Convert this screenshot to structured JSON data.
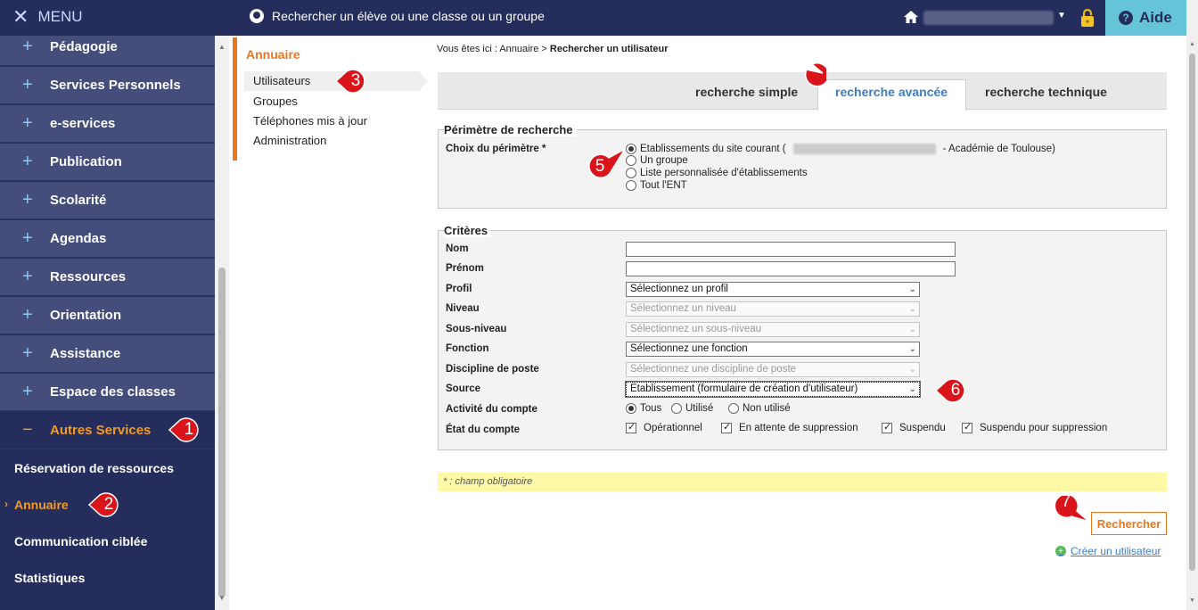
{
  "topbar": {
    "menu_label": "MENU",
    "search_placeholder": "Rechercher un élève ou une classe ou un groupe",
    "help_label": "Aide"
  },
  "sidebar": {
    "items": [
      {
        "label": "Pédagogie",
        "icon": "+"
      },
      {
        "label": "Services Personnels",
        "icon": "+"
      },
      {
        "label": "e-services",
        "icon": "+"
      },
      {
        "label": "Publication",
        "icon": "+"
      },
      {
        "label": "Scolarité",
        "icon": "+"
      },
      {
        "label": "Agendas",
        "icon": "+"
      },
      {
        "label": "Ressources",
        "icon": "+"
      },
      {
        "label": "Orientation",
        "icon": "+"
      },
      {
        "label": "Assistance",
        "icon": "+"
      },
      {
        "label": "Espace des classes",
        "icon": "+"
      },
      {
        "label": "Autres Services",
        "icon": "−"
      }
    ],
    "subitems": [
      {
        "label": "Réservation de ressources"
      },
      {
        "label": "Annuaire"
      },
      {
        "label": "Communication ciblée"
      },
      {
        "label": "Statistiques"
      }
    ],
    "accent_color": "#f39a1f"
  },
  "submenu": {
    "title": "Annuaire",
    "links": [
      "Utilisateurs",
      "Groupes",
      "Téléphones mis à jour",
      "Administration"
    ]
  },
  "breadcrumb": {
    "prefix": "Vous êtes ici : Annuaire > ",
    "current": "Rechercher un utilisateur"
  },
  "tabs": [
    "recherche simple",
    "recherche avancée",
    "recherche technique"
  ],
  "perimetre": {
    "legend": "Périmètre de recherche",
    "label": "Choix du périmètre *",
    "options": [
      {
        "before": "Etablissements du site courant (",
        "after": "- Académie de Toulouse)",
        "selected": true
      },
      {
        "text": "Un groupe",
        "selected": false
      },
      {
        "text": "Liste personnalisée d'établissements",
        "selected": false
      },
      {
        "text": "Tout l'ENT",
        "selected": false
      }
    ]
  },
  "criteres": {
    "legend": "Critères",
    "fields": {
      "nom": {
        "label": "Nom",
        "value": ""
      },
      "prenom": {
        "label": "Prénom",
        "value": ""
      },
      "profil": {
        "label": "Profil",
        "value": "Sélectionnez un profil"
      },
      "niveau": {
        "label": "Niveau",
        "value": "Sélectionnez un niveau"
      },
      "sous_niveau": {
        "label": "Sous-niveau",
        "value": "Sélectionnez un sous-niveau"
      },
      "fonction": {
        "label": "Fonction",
        "value": "Sélectionnez une fonction"
      },
      "discipline": {
        "label": "Discipline de poste",
        "value": "Sélectionnez une discipline de poste"
      },
      "source": {
        "label": "Source",
        "value": "Etablissement (formulaire de création d'utilisateur)"
      }
    },
    "activite": {
      "label": "Activité du compte",
      "options": [
        {
          "text": "Tous",
          "selected": true
        },
        {
          "text": "Utilisé",
          "selected": false
        },
        {
          "text": "Non utilisé",
          "selected": false
        }
      ]
    },
    "etat": {
      "label": "État du compte",
      "options": [
        {
          "text": "Opérationnel",
          "checked": true
        },
        {
          "text": "En attente de suppression",
          "checked": true
        },
        {
          "text": "Suspendu",
          "checked": true
        },
        {
          "text": "Suspendu pour suppression",
          "checked": true
        }
      ]
    }
  },
  "note": "* : champ obligatoire",
  "actions": {
    "search_label": "Rechercher",
    "create_label": "Créer un utilisateur"
  },
  "markers": [
    "1",
    "2",
    "3",
    "4",
    "5",
    "6",
    "7"
  ],
  "colors": {
    "navy": "#242d5c",
    "orange": "#e87722",
    "marker_red": "#d9141b",
    "help_bg": "#66c4d8"
  }
}
